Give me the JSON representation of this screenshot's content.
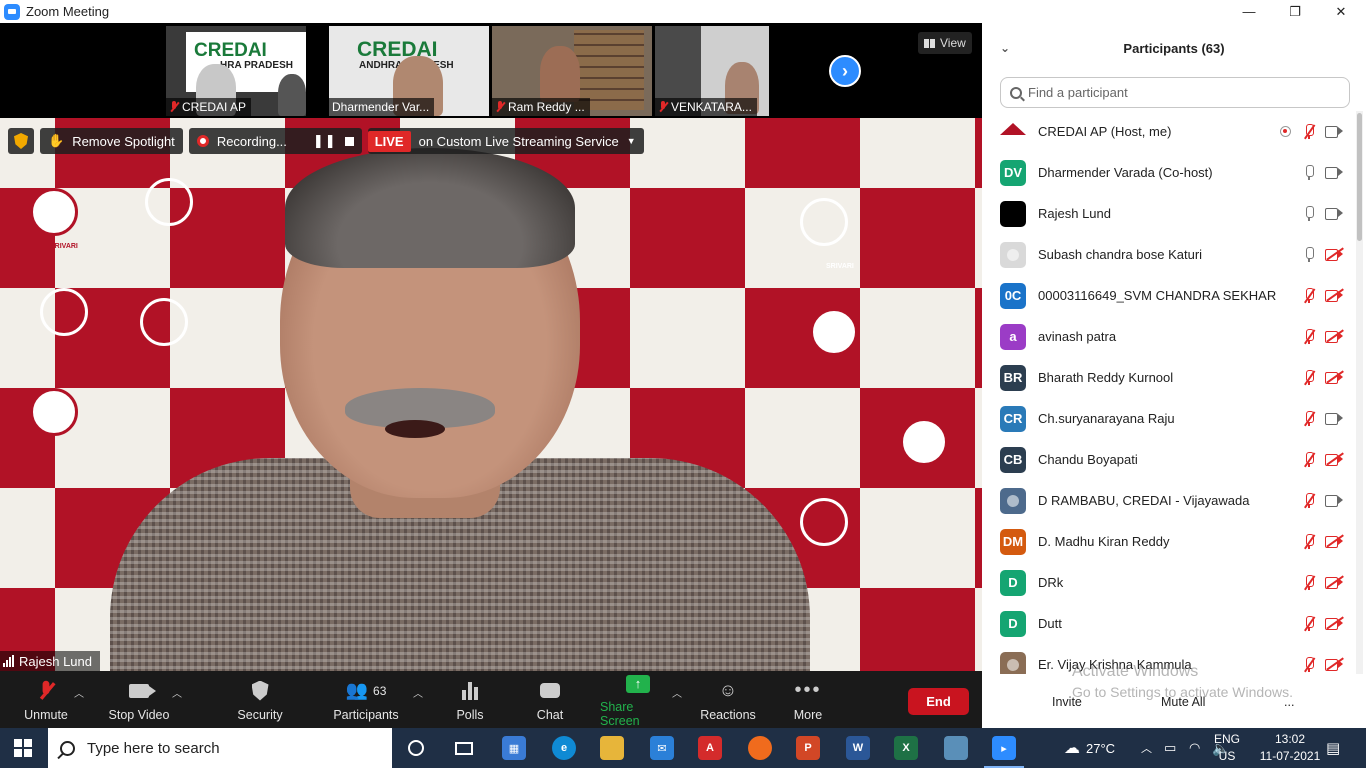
{
  "window": {
    "title": "Zoom Meeting",
    "minimize": "—",
    "restore": "❐",
    "close": "✕"
  },
  "thumbnails": [
    {
      "name": "CREDAI AP",
      "logo": "CREDAI",
      "sub": "HRA PRADESH",
      "muted": true
    },
    {
      "name": "Dharmender Var...",
      "logo": "CREDAI",
      "sub": "ANDHRA PRADESH",
      "muted": false
    },
    {
      "name": "Ram Reddy ...",
      "muted": true
    },
    {
      "name": "VENKATARA...",
      "muted": true
    }
  ],
  "view_button": "View",
  "top_bar": {
    "remove_spotlight": "Remove Spotlight",
    "recording": "Recording...",
    "live": "LIVE",
    "streaming": "on Custom Live Streaming Service"
  },
  "speaker_name": "Rajesh Lund",
  "backdrop_brand": "SRIVARI",
  "controls": {
    "unmute": "Unmute",
    "stop_video": "Stop Video",
    "security": "Security",
    "participants": "Participants",
    "participants_count": "63",
    "polls": "Polls",
    "chat": "Chat",
    "share_screen": "Share Screen",
    "reactions": "Reactions",
    "more": "More",
    "end": "End"
  },
  "panel": {
    "title": "Participants (63)",
    "search_placeholder": "Find a participant",
    "participants": [
      {
        "name": "CREDAI AP (Host, me)",
        "initials": "",
        "color": "#ffffff",
        "mic": "muted",
        "video": "on",
        "recording": true,
        "avatar_type": "logo"
      },
      {
        "name": "Dharmender Varada (Co-host)",
        "initials": "DV",
        "color": "#15a572",
        "mic": "on",
        "video": "on"
      },
      {
        "name": "Rajesh Lund",
        "initials": "",
        "color": "#000000",
        "mic": "on",
        "video": "on"
      },
      {
        "name": "Subash chandra bose Katuri",
        "initials": "",
        "color": "#d9d9d9",
        "mic": "on",
        "video": "off",
        "avatar_type": "photo"
      },
      {
        "name": "00003116649_SVM CHANDRA SEKHAR",
        "initials": "0C",
        "color": "#1a73c9",
        "mic": "muted",
        "video": "off"
      },
      {
        "name": "avinash patra",
        "initials": "a",
        "color": "#9b3cc6",
        "mic": "muted",
        "video": "off"
      },
      {
        "name": "Bharath Reddy Kurnool",
        "initials": "BR",
        "color": "#2c3e50",
        "mic": "muted",
        "video": "off"
      },
      {
        "name": "Ch.suryanarayana Raju",
        "initials": "CR",
        "color": "#2a7ab8",
        "mic": "muted",
        "video": "on"
      },
      {
        "name": "Chandu Boyapati",
        "initials": "CB",
        "color": "#2c3e50",
        "mic": "muted",
        "video": "off"
      },
      {
        "name": "D RAMBABU, CREDAI - Vijayawada",
        "initials": "",
        "color": "#4d6a8c",
        "mic": "muted",
        "video": "on",
        "avatar_type": "photo"
      },
      {
        "name": "D. Madhu Kiran Reddy",
        "initials": "DM",
        "color": "#d45a0f",
        "mic": "muted",
        "video": "off"
      },
      {
        "name": "DRk",
        "initials": "D",
        "color": "#15a572",
        "mic": "muted",
        "video": "off"
      },
      {
        "name": "Dutt",
        "initials": "D",
        "color": "#15a572",
        "mic": "muted",
        "video": "off"
      },
      {
        "name": "Er. Vijay Krishna Kammula",
        "initials": "",
        "color": "#8a6d55",
        "mic": "muted",
        "video": "off",
        "avatar_type": "photo"
      }
    ],
    "invite": "Invite",
    "mute_all": "Mute All",
    "more": "...",
    "watermark_1": "Activate Windows",
    "watermark_2": "Go to Settings to activate Windows."
  },
  "taskbar": {
    "search_placeholder": "Type here to search",
    "weather": "27°C",
    "lang_1": "ENG",
    "lang_2": "US",
    "time": "13:02",
    "date": "11-07-2021"
  }
}
